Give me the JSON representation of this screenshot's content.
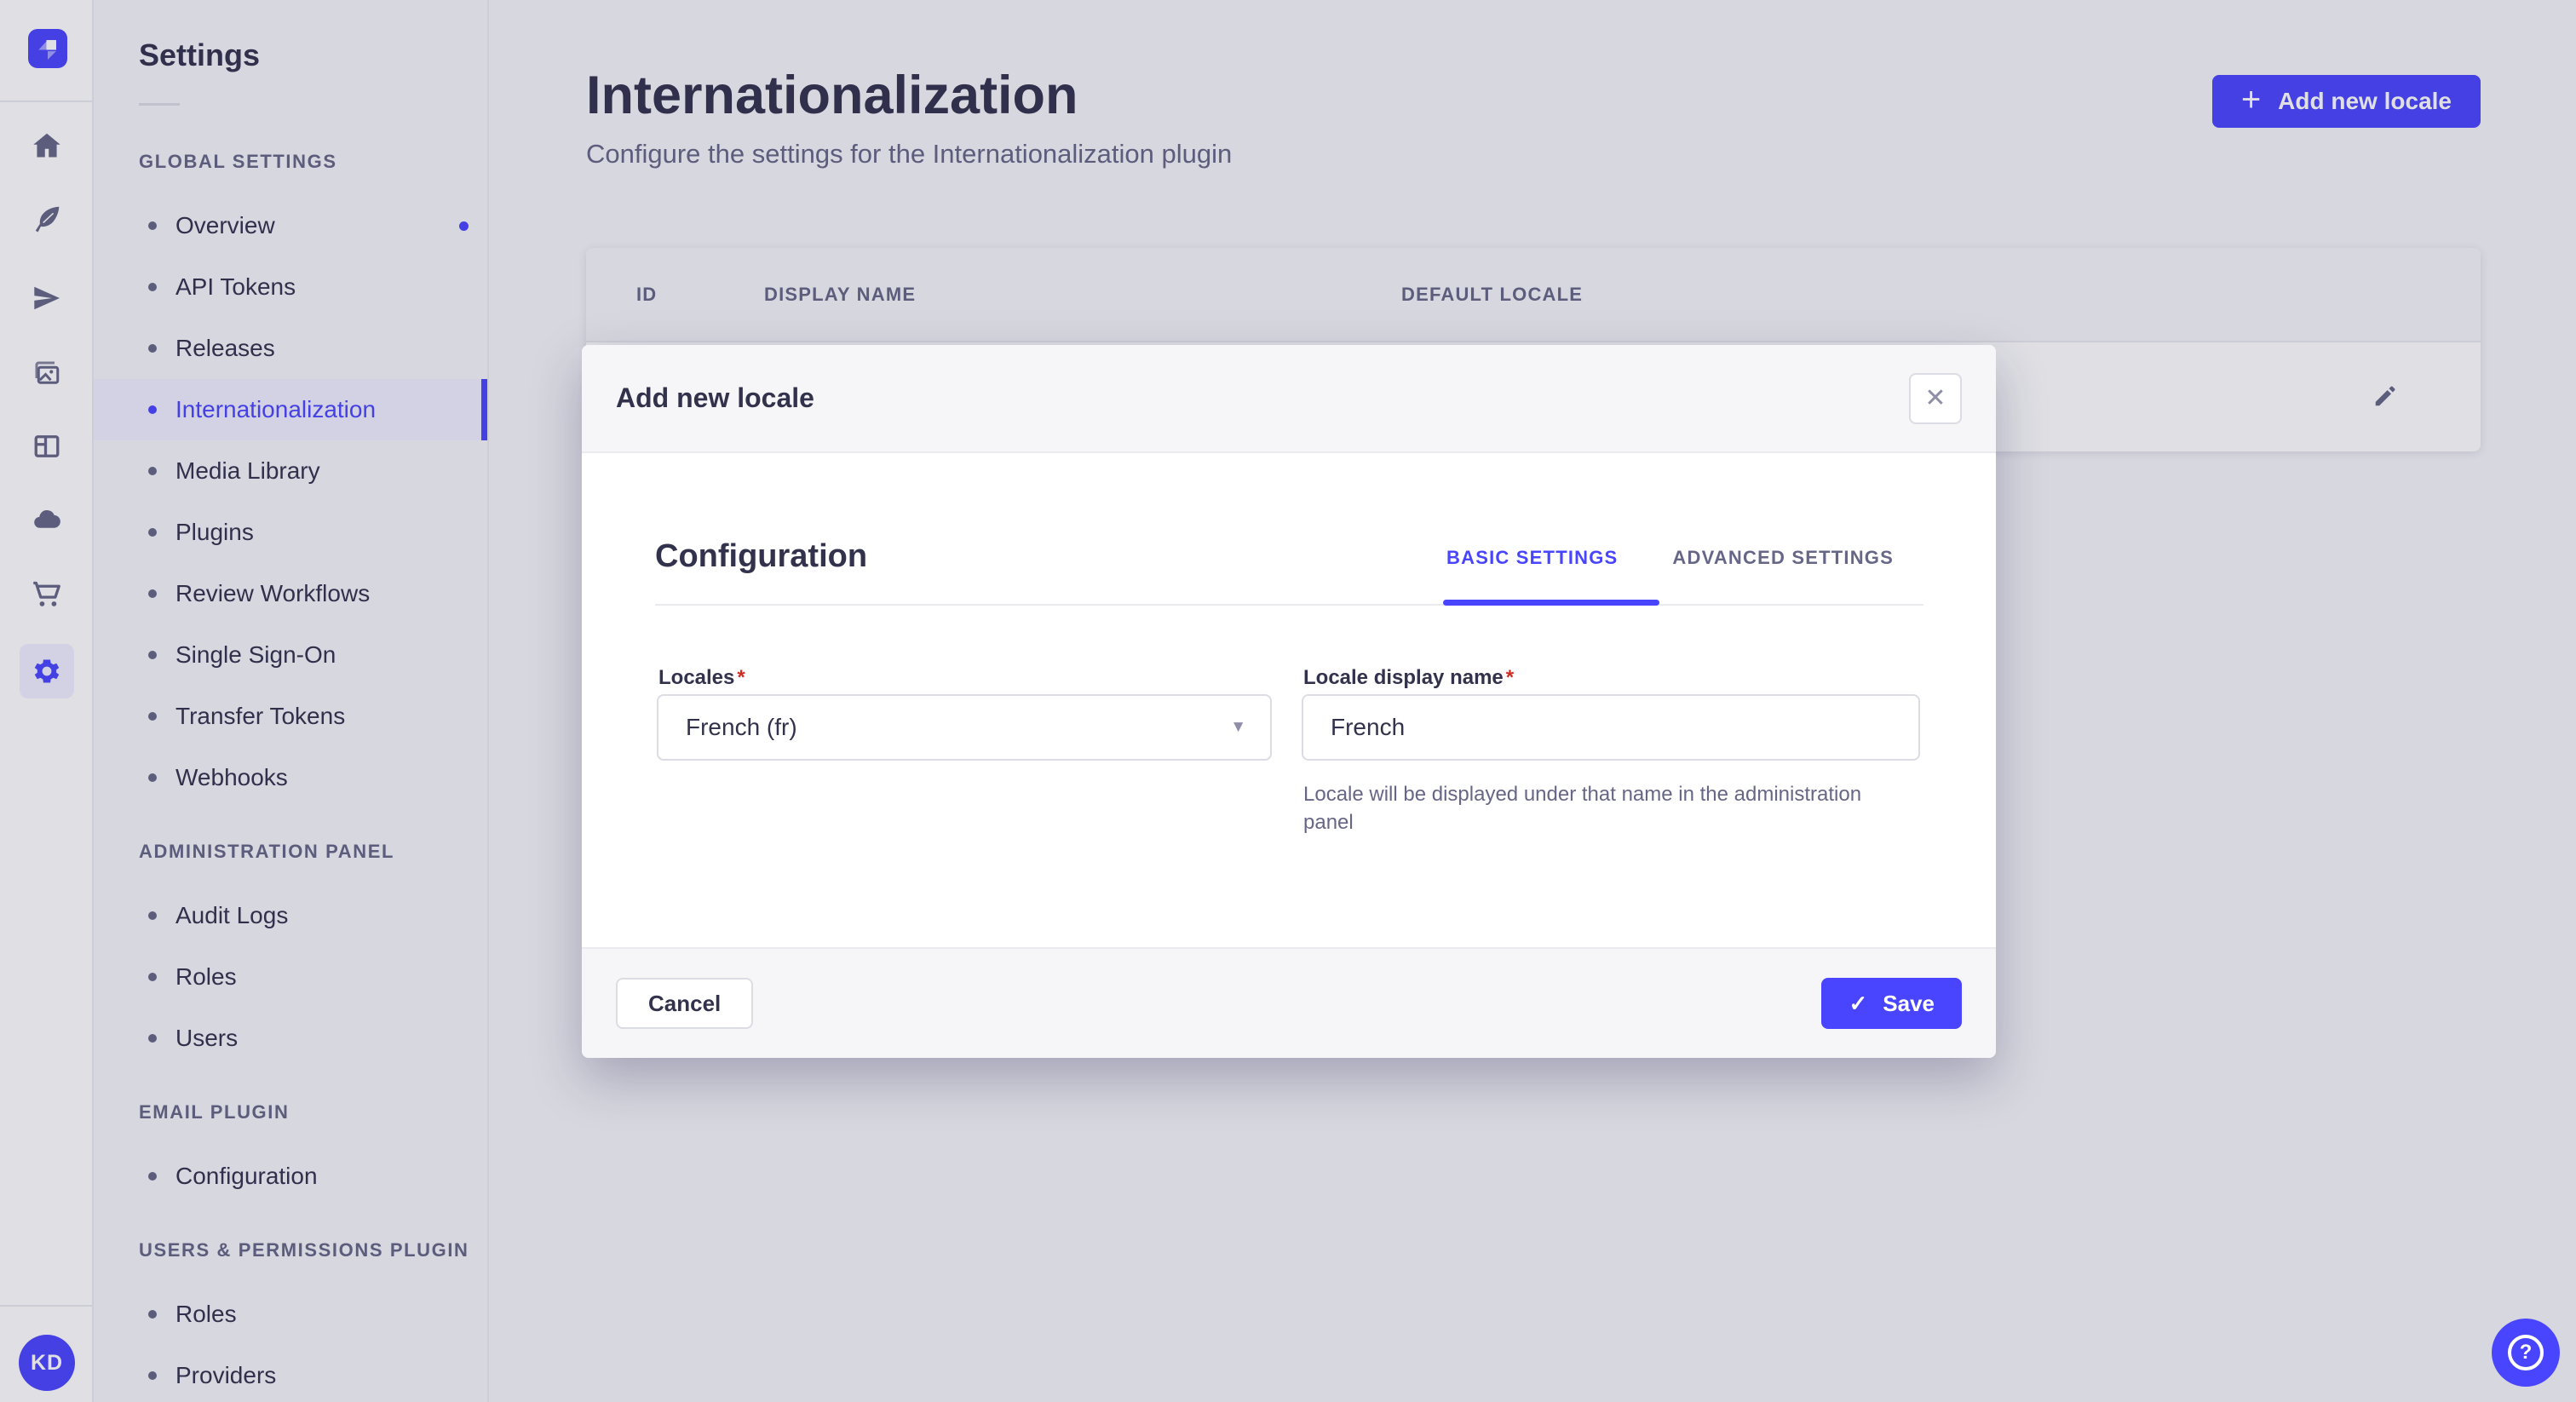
{
  "colors": {
    "primary": "#4945ff",
    "danger": "#d02b20",
    "text": "#32324d",
    "text_muted": "#666687"
  },
  "rail": {
    "logo": "strapi-logo",
    "icons": [
      "home",
      "feather",
      "paper-plane",
      "images",
      "layout",
      "cloud",
      "cart",
      "settings-gear"
    ],
    "active_icon": "settings-gear",
    "avatar_initials": "KD"
  },
  "sidebar": {
    "title": "Settings",
    "sections": [
      {
        "label": "GLOBAL SETTINGS",
        "items": [
          {
            "label": "Overview",
            "notification": true
          },
          {
            "label": "API Tokens"
          },
          {
            "label": "Releases"
          },
          {
            "label": "Internationalization",
            "active": true
          },
          {
            "label": "Media Library"
          },
          {
            "label": "Plugins"
          },
          {
            "label": "Review Workflows"
          },
          {
            "label": "Single Sign-On"
          },
          {
            "label": "Transfer Tokens"
          },
          {
            "label": "Webhooks"
          }
        ]
      },
      {
        "label": "ADMINISTRATION PANEL",
        "items": [
          {
            "label": "Audit Logs"
          },
          {
            "label": "Roles"
          },
          {
            "label": "Users"
          }
        ]
      },
      {
        "label": "EMAIL PLUGIN",
        "items": [
          {
            "label": "Configuration"
          }
        ]
      },
      {
        "label": "USERS & PERMISSIONS PLUGIN",
        "items": [
          {
            "label": "Roles"
          },
          {
            "label": "Providers"
          }
        ]
      }
    ]
  },
  "header": {
    "title": "Internationalization",
    "subtitle": "Configure the settings for the Internationalization plugin",
    "add_button": "Add new locale"
  },
  "table": {
    "columns": [
      "ID",
      "DISPLAY NAME",
      "DEFAULT LOCALE"
    ],
    "row_action": "edit-pencil"
  },
  "modal": {
    "title": "Add new locale",
    "section_title": "Configuration",
    "tabs": [
      {
        "label": "BASIC SETTINGS",
        "active": true
      },
      {
        "label": "ADVANCED SETTINGS",
        "active": false
      }
    ],
    "fields": {
      "locales": {
        "label": "Locales",
        "required": true,
        "value": "French (fr)"
      },
      "display_name": {
        "label": "Locale display name",
        "required": true,
        "value": "French",
        "help": "Locale will be displayed under that name in the administration panel"
      }
    },
    "cancel_button": "Cancel",
    "save_button": "Save"
  },
  "fab": {
    "icon": "question-mark"
  }
}
